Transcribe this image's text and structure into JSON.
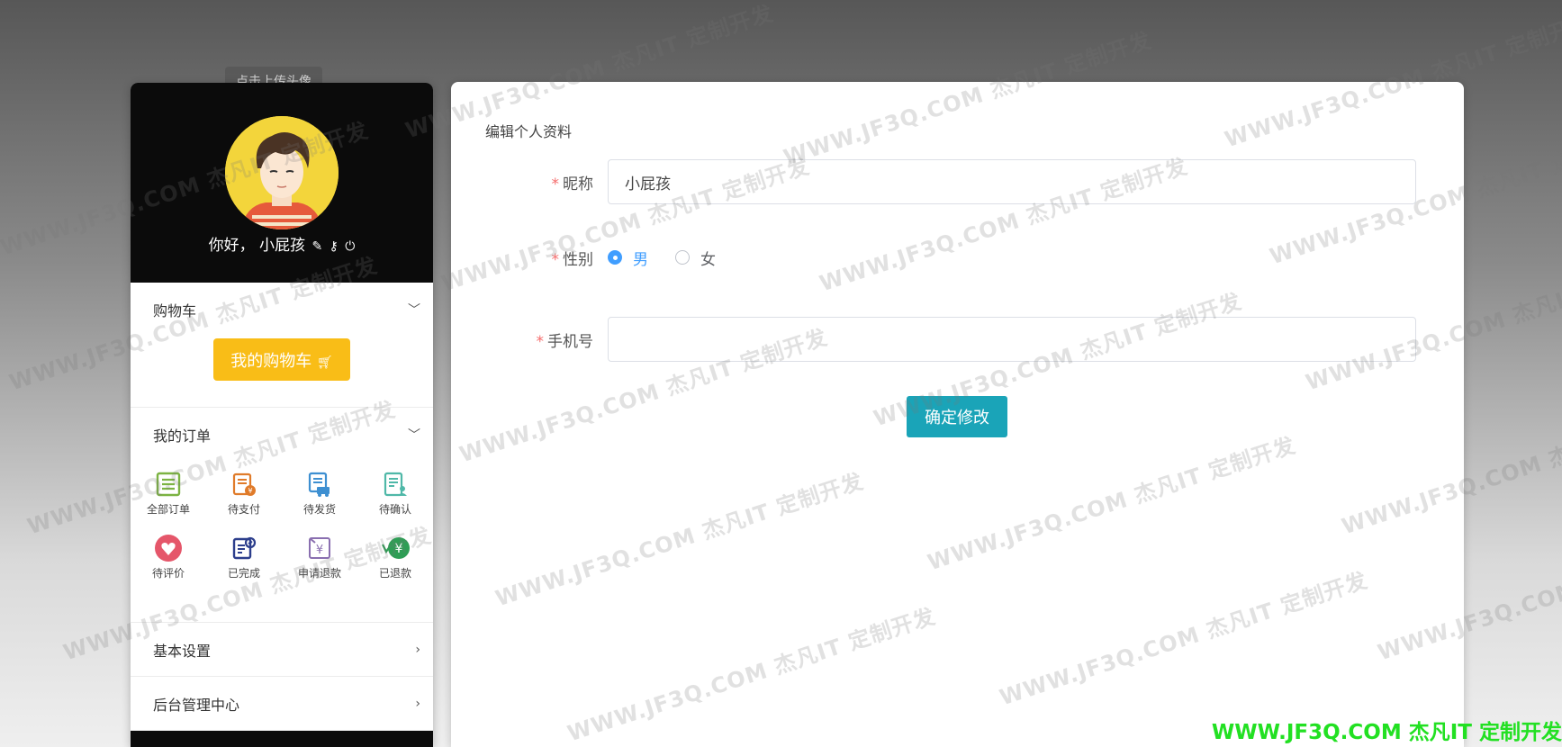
{
  "tooltip": "点击上传头像",
  "profile": {
    "greeting": "你好， 小屁孩",
    "edit_icon": "edit-icon",
    "key_icon": "key-icon",
    "logout_icon": "power-icon"
  },
  "cart": {
    "title": "购物车",
    "button_label": "我的购物车",
    "cart_icon": "cart-icon"
  },
  "orders": {
    "title": "我的订单",
    "items": [
      {
        "label": "全部订单",
        "icon": "all-orders-icon",
        "color": "#7cb342"
      },
      {
        "label": "待支付",
        "icon": "pending-payment-icon",
        "color": "#e07b2a"
      },
      {
        "label": "待发货",
        "icon": "pending-shipment-icon",
        "color": "#3d8fd1"
      },
      {
        "label": "待确认",
        "icon": "pending-confirm-icon",
        "color": "#4fb8a8"
      },
      {
        "label": "待评价",
        "icon": "pending-review-icon",
        "color": "#e5566a"
      },
      {
        "label": "已完成",
        "icon": "completed-icon",
        "color": "#2c3e8c"
      },
      {
        "label": "申请退款",
        "icon": "refund-request-icon",
        "color": "#8a6fb0"
      },
      {
        "label": "已退款",
        "icon": "refunded-icon",
        "color": "#2e9e55"
      }
    ]
  },
  "menu": {
    "basic_settings": "基本设置",
    "admin_center": "后台管理中心"
  },
  "form": {
    "title": "编辑个人资料",
    "nickname_label": "昵称",
    "nickname_value": "小屁孩",
    "gender_label": "性别",
    "gender_male": "男",
    "gender_female": "女",
    "phone_label": "手机号",
    "phone_value": "",
    "submit_label": "确定修改",
    "required_mark": "*"
  },
  "watermark": {
    "text": "WWW.JF3Q.COM 杰凡IT  定制开发",
    "corner_text": "WWW.JF3Q.COM 杰凡IT  定制开发"
  },
  "colors": {
    "cart_button": "#f9bd17",
    "submit_button": "#1aa4b8",
    "radio_active": "#409eff",
    "required": "#f56c6c",
    "corner_watermark": "#22e022"
  }
}
